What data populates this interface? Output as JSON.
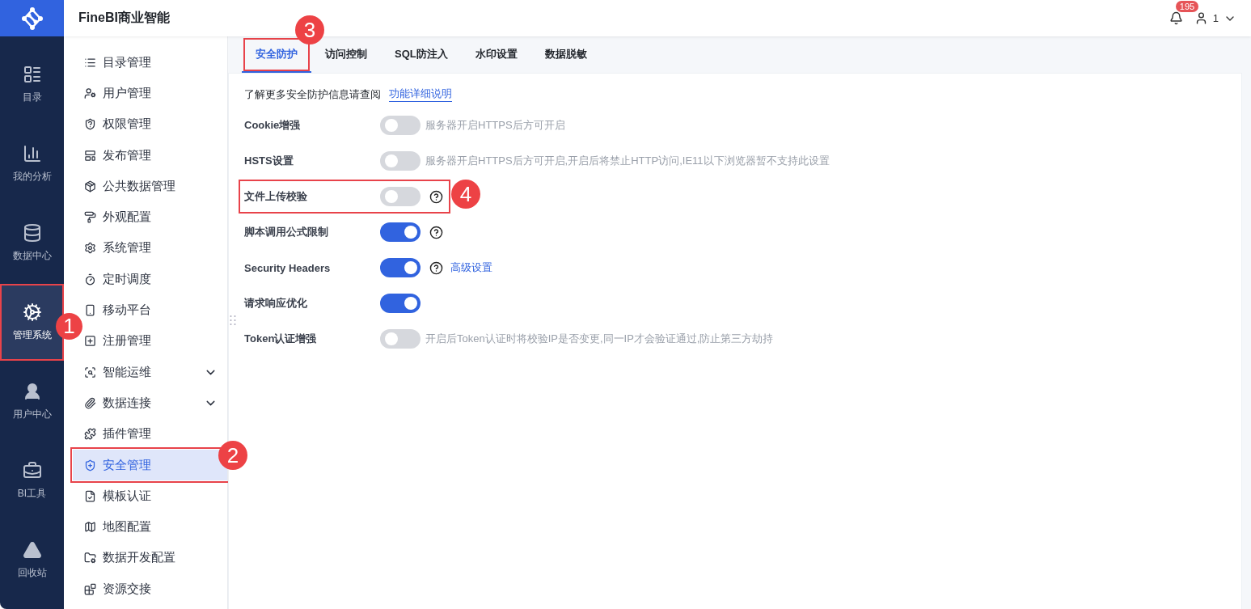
{
  "app": {
    "title": "FineBI商业智能"
  },
  "header": {
    "notifications": "195",
    "user": "1"
  },
  "rail": [
    {
      "label": "目录",
      "selected": false
    },
    {
      "label": "我的分析",
      "selected": false
    },
    {
      "label": "数据中心",
      "selected": false
    },
    {
      "label": "管理系统",
      "selected": true,
      "callout": "1"
    },
    {
      "label": "用户中心",
      "selected": false
    },
    {
      "label": "BI工具",
      "selected": false
    },
    {
      "label": "回收站",
      "selected": false
    }
  ],
  "submenu": [
    {
      "label": "目录管理",
      "selected": false
    },
    {
      "label": "用户管理",
      "selected": false
    },
    {
      "label": "权限管理",
      "selected": false
    },
    {
      "label": "发布管理",
      "selected": false
    },
    {
      "label": "公共数据管理",
      "selected": false
    },
    {
      "label": "外观配置",
      "selected": false
    },
    {
      "label": "系统管理",
      "selected": false
    },
    {
      "label": "定时调度",
      "selected": false
    },
    {
      "label": "移动平台",
      "selected": false
    },
    {
      "label": "注册管理",
      "selected": false
    },
    {
      "label": "智能运维",
      "selected": false,
      "expanded": false
    },
    {
      "label": "数据连接",
      "selected": false,
      "expanded": false
    },
    {
      "label": "插件管理",
      "selected": false
    },
    {
      "label": "安全管理",
      "selected": true,
      "callout": "2"
    },
    {
      "label": "模板认证",
      "selected": false
    },
    {
      "label": "地图配置",
      "selected": false
    },
    {
      "label": "数据开发配置",
      "selected": false
    },
    {
      "label": "资源交接",
      "selected": false
    }
  ],
  "tabs": [
    {
      "label": "安全防护",
      "selected": true,
      "callout": "3"
    },
    {
      "label": "访问控制",
      "selected": false
    },
    {
      "label": "SQL防注入",
      "selected": false
    },
    {
      "label": "水印设置",
      "selected": false
    },
    {
      "label": "数据脱敏",
      "selected": false
    }
  ],
  "intro": {
    "text": "了解更多安全防护信息请查阅",
    "link": "功能详细说明"
  },
  "settings": [
    {
      "label": "Cookie增强",
      "on": false,
      "help": false,
      "note": "服务器开启HTTPS后方可开启"
    },
    {
      "label": "HSTS设置",
      "on": false,
      "help": false,
      "note": "服务器开启HTTPS后方可开启,开启后将禁止HTTP访问,IE11以下浏览器暂不支持此设置"
    },
    {
      "label": "文件上传校验",
      "on": false,
      "help": true,
      "callout": "4"
    },
    {
      "label": "脚本调用公式限制",
      "on": true,
      "help": true
    },
    {
      "label": "Security Headers",
      "on": true,
      "help": true,
      "link": "高级设置"
    },
    {
      "label": "请求响应优化",
      "on": true,
      "help": false
    },
    {
      "label": "Token认证增强",
      "on": false,
      "help": false,
      "note": "开启后Token认证时将校验IP是否变更,同一IP才会验证通过,防止第三方劫持"
    }
  ]
}
